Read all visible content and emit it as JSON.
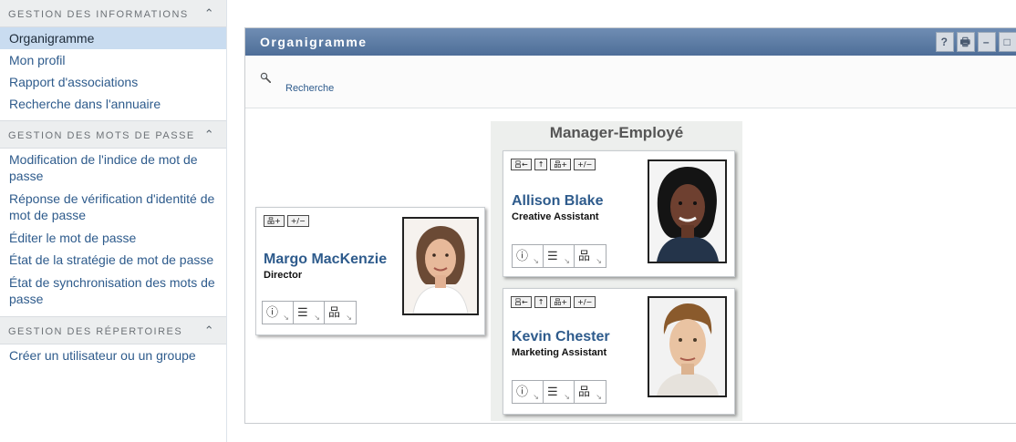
{
  "sidebar": {
    "sections": [
      {
        "header": "GESTION DES INFORMATIONS",
        "items": [
          "Organigramme",
          "Mon profil",
          "Rapport d'associations",
          "Recherche dans l'annuaire"
        ]
      },
      {
        "header": "GESTION DES MOTS DE PASSE",
        "items": [
          "Modification de l'indice de mot de passe",
          "Réponse de vérification d'identité de mot de passe",
          "Éditer le mot de passe",
          "État de la stratégie de mot de passe",
          "État de synchronisation des mots de passe"
        ]
      },
      {
        "header": "GESTION DES RÉPERTOIRES",
        "items": [
          "Créer un utilisateur ou un groupe"
        ]
      }
    ],
    "active_item": "Organigramme"
  },
  "panel": {
    "title": "Organigramme",
    "tools": [
      "?",
      "🖶",
      "–",
      "□"
    ],
    "search_label": "Recherche"
  },
  "orgchart": {
    "relationship_title": "Manager-Employé",
    "manager": {
      "name": "Margo MacKenzie",
      "title": "Director",
      "tools": [
        "品+",
        "+/−"
      ]
    },
    "reports": [
      {
        "name": "Allison Blake",
        "title": "Creative Assistant",
        "tools": [
          "吕←",
          "↑",
          "品+",
          "+/−"
        ]
      },
      {
        "name": "Kevin Chester",
        "title": "Marketing Assistant",
        "tools": [
          "吕←",
          "↑",
          "品+",
          "+/−"
        ]
      }
    ],
    "actions": [
      "ⓘ",
      "☰",
      "品"
    ]
  },
  "colors": {
    "panel_header": "#5d7ca5",
    "link": "#2e5b8c",
    "active_bg": "#c9dcf0"
  }
}
